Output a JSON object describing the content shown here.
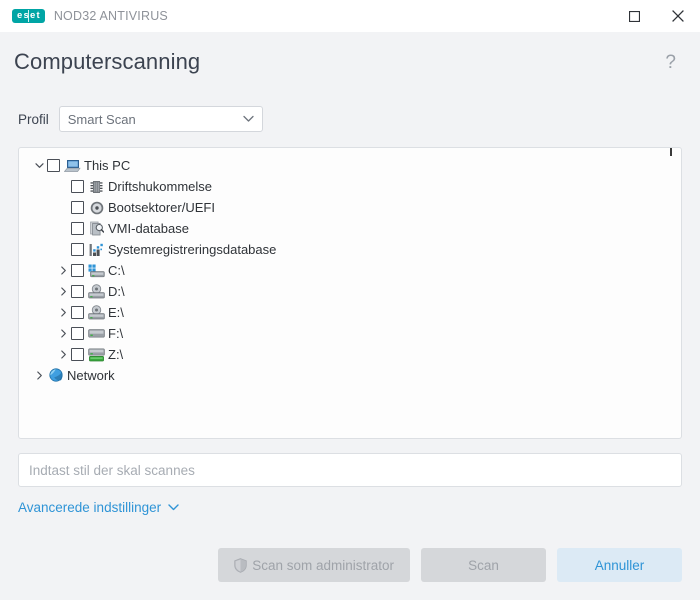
{
  "window": {
    "brand_mark": "eset",
    "product_name": "NOD32 ANTIVIRUS",
    "maximize_title": "Maximer",
    "close_title": "Luk",
    "accent_teal": "#00a5a5",
    "accent_blue": "#2f94d6"
  },
  "header": {
    "title": "Computerscanning",
    "help_glyph": "?"
  },
  "profile": {
    "label": "Profil",
    "selected": "Smart Scan",
    "options": [
      "Smart Scan"
    ]
  },
  "tree": {
    "nodes": [
      {
        "label": "This PC",
        "icon": "computer-icon",
        "level": 0,
        "expanded": true,
        "has_children": true,
        "has_checkbox": true,
        "checked": false
      },
      {
        "label": "Driftshukommelse",
        "icon": "memory-icon",
        "level": 1,
        "expanded": false,
        "has_children": false,
        "has_checkbox": true,
        "checked": false
      },
      {
        "label": "Bootsektorer/UEFI",
        "icon": "disc-icon",
        "level": 1,
        "expanded": false,
        "has_children": false,
        "has_checkbox": true,
        "checked": false
      },
      {
        "label": "VMI-database",
        "icon": "document-search-icon",
        "level": 1,
        "expanded": false,
        "has_children": false,
        "has_checkbox": true,
        "checked": false
      },
      {
        "label": "Systemregistreringsdatabase",
        "icon": "registry-icon",
        "level": 1,
        "expanded": false,
        "has_children": false,
        "has_checkbox": true,
        "checked": false
      },
      {
        "label": "C:\\",
        "icon": "windows-drive-icon",
        "level": 1,
        "expanded": false,
        "has_children": true,
        "has_checkbox": true,
        "checked": false
      },
      {
        "label": "D:\\",
        "icon": "optical-drive-icon",
        "level": 1,
        "expanded": false,
        "has_children": true,
        "has_checkbox": true,
        "checked": false
      },
      {
        "label": "E:\\",
        "icon": "optical-drive-icon",
        "level": 1,
        "expanded": false,
        "has_children": true,
        "has_checkbox": true,
        "checked": false
      },
      {
        "label": "F:\\",
        "icon": "hard-drive-icon",
        "level": 1,
        "expanded": false,
        "has_children": true,
        "has_checkbox": true,
        "checked": false
      },
      {
        "label": "Z:\\",
        "icon": "network-drive-icon",
        "level": 1,
        "expanded": false,
        "has_children": true,
        "has_checkbox": true,
        "checked": false
      },
      {
        "label": "Network",
        "icon": "globe-icon",
        "level": 0,
        "expanded": false,
        "has_children": true,
        "has_checkbox": false,
        "checked": false
      }
    ]
  },
  "path_field": {
    "value": "",
    "placeholder": "Indtast stil der skal scannes"
  },
  "advanced": {
    "label": "Avancerede indstillinger"
  },
  "footer": {
    "scan_admin_label": "Scan som administrator",
    "scan_label": "Scan",
    "cancel_label": "Annuller"
  }
}
